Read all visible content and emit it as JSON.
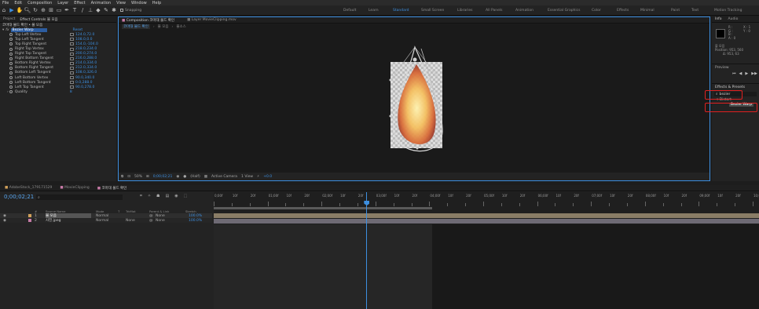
{
  "menu": [
    "File",
    "Edit",
    "Composition",
    "Layer",
    "Effect",
    "Animation",
    "View",
    "Window",
    "Help"
  ],
  "toolbar": {
    "snapping_label": "Snapping",
    "workspaces": [
      {
        "label": "Default",
        "active": false
      },
      {
        "label": "Learn",
        "active": false
      },
      {
        "label": "Standard",
        "active": true
      },
      {
        "label": "Small Screen",
        "active": false
      },
      {
        "label": "Libraries",
        "active": false
      },
      {
        "label": "All Panels",
        "active": false
      },
      {
        "label": "Animation",
        "active": false
      },
      {
        "label": "Essential Graphics",
        "active": false
      },
      {
        "label": "Color",
        "active": false
      },
      {
        "label": "Effects",
        "active": false
      },
      {
        "label": "Minimal",
        "active": false
      },
      {
        "label": "Paint",
        "active": false
      },
      {
        "label": "Text",
        "active": false
      },
      {
        "label": "Motion Tracking",
        "active": false
      }
    ]
  },
  "project_panel": {
    "tab_project": "Project",
    "tab_effect_controls": "Effect Controls 불 모음",
    "breadcrumb": "코마대 불드 확인 • 불 모음",
    "effect_name": "Bezier Warp",
    "reset_label": "Reset",
    "properties": [
      {
        "name": "Top Left Vertex",
        "value": "124.0,72.0"
      },
      {
        "name": "Top Left Tangent",
        "value": "108.0,0.0"
      },
      {
        "name": "Top Right Tangent",
        "value": "154.0,-104.0"
      },
      {
        "name": "Right Top Vertex",
        "value": "218.0,234.0"
      },
      {
        "name": "Right Top Tangent",
        "value": "200.0,274.0"
      },
      {
        "name": "Right Bottom Tangent",
        "value": "216.0,288.0"
      },
      {
        "name": "Bottom Right Vertex",
        "value": "214.0,334.0"
      },
      {
        "name": "Bottom Right Tangent",
        "value": "212.0,334.0"
      },
      {
        "name": "Bottom Left Tangent",
        "value": "108.0,326.0"
      },
      {
        "name": "Left Bottom Vertex",
        "value": "90.0,340.0"
      },
      {
        "name": "Left Bottom Tangent",
        "value": "0.0,288.0"
      },
      {
        "name": "Left Top Tangent",
        "value": "90.0,278.0"
      },
      {
        "name": "Quality",
        "value": "8"
      }
    ]
  },
  "comp_panel": {
    "tab_label": "Composition 코마대 불드 확인",
    "layer_tab": "Layer MovieClipping.mov",
    "breadcrumbs": [
      "코마대 불드 확인",
      "불 모음",
      "불소스"
    ],
    "zoom": "50%",
    "timecode": "0;00;02;21",
    "resolution": "(Half)",
    "camera": "Active Camera",
    "views": "1 View",
    "exposure": "+0.0"
  },
  "right_panel": {
    "info_tab": "Info",
    "audio_tab": "Audio",
    "info_rgb": [
      "R :",
      "G :",
      "B :",
      "A : 0"
    ],
    "info_xy": [
      "X : 1",
      "Y : 0"
    ],
    "layer_name": "불 모음",
    "position": "Position: 953, 560",
    "delta": "Δ: 953, 63",
    "preview_tab": "Preview",
    "effects_tab": "Effects & Presets",
    "search_value": "bezier",
    "category": "Distort",
    "result": "Bezier Warp"
  },
  "timeline": {
    "tabs": [
      {
        "label": "AdobeStock_179171529",
        "color": "#d2a15a",
        "active": false
      },
      {
        "label": "MovieClipping",
        "color": "#c87ba8",
        "active": false
      },
      {
        "label": "코마대 불드 확인",
        "color": "#c87ba8",
        "active": true
      }
    ],
    "timecode": "0;00;02;21",
    "search_placeholder": "",
    "columns": [
      "#",
      "Source Name",
      "Mode",
      "T",
      "TrkMat",
      "Parent & Link",
      "Stretch"
    ],
    "layers": [
      {
        "num": "1",
        "name": "불 모음",
        "mode": "Normal",
        "trkmat": "",
        "parent": "None",
        "stretch": "100.0%",
        "color": "#d2a15a"
      },
      {
        "num": "2",
        "name": "사진.jpeg",
        "mode": "Normal",
        "trkmat": "None",
        "parent": "None",
        "stretch": "100.0%",
        "color": "#c87ba8"
      }
    ],
    "ruler_labels": [
      "0;00f",
      "10f",
      "20f",
      "01;00f",
      "10f",
      "20f",
      "02;00f",
      "10f",
      "20f",
      "03;00f",
      "10f",
      "20f",
      "04;00f",
      "10f",
      "20f",
      "05;00f",
      "10f",
      "20f",
      "06;00f",
      "10f",
      "20f",
      "07;00f",
      "10f",
      "20f",
      "08;00f",
      "10f",
      "20f",
      "09;00f",
      "10f",
      "20f",
      "10;0"
    ],
    "playhead_fraction": 0.28
  }
}
